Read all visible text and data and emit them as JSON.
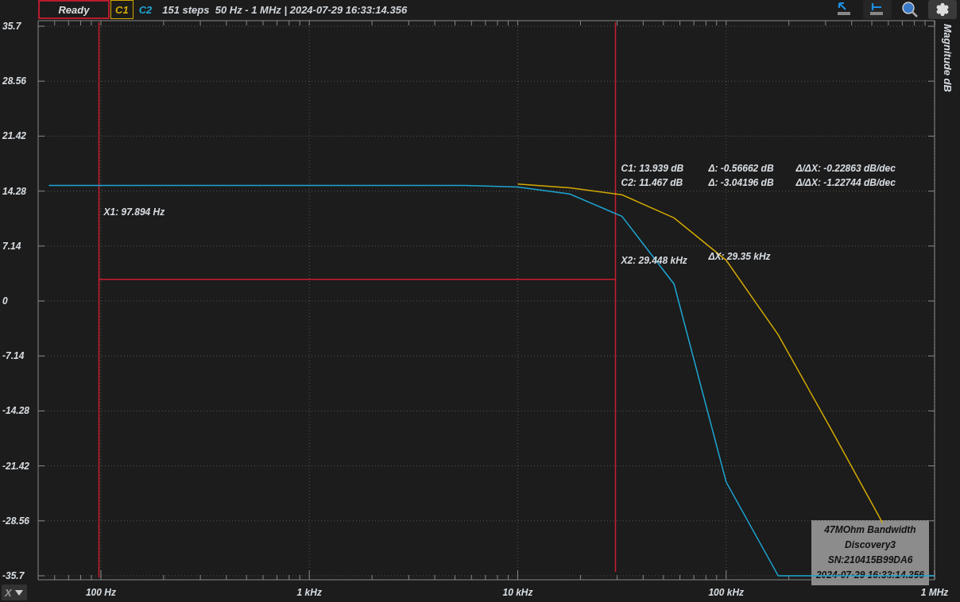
{
  "status": "Ready",
  "channels": [
    {
      "selected": true
    },
    {
      "selected": false
    }
  ],
  "sweep_info": "151 steps  50 Hz - 1 MHz | 2024-07-29 16:33:14.356",
  "cursor_labels": [
    "X1: 97.894 Hz",
    "X2: 29.448 kHz"
  ],
  "chart_data": {
    "type": "line",
    "ylabel": "Magnitude dB",
    "ylim": [
      -35.7,
      35.7
    ],
    "grid": true,
    "ref_lines": [
      {
        "axis": "y",
        "value": 2.8
      }
    ],
    "categories": [
      null,
      "100 Hz",
      null,
      null,
      null,
      "1 kHz",
      null,
      null,
      null,
      "10 kHz",
      null,
      null,
      null,
      "100 kHz",
      null,
      null,
      null,
      "1 MHz"
    ],
    "series": [
      {
        "name": "C1",
        "color": "#d4aa00",
        "values": [
          null,
          null,
          null,
          null,
          null,
          null,
          null,
          null,
          null,
          15.2,
          14.7,
          13.8,
          10.8,
          5.3,
          -4.4,
          -16.5,
          -28.8,
          null
        ]
      },
      {
        "name": "C2",
        "color": "#1ea5d2",
        "values": [
          15,
          15,
          15,
          15,
          15,
          15,
          15,
          15,
          15,
          14.8,
          13.9,
          11,
          2.2,
          -23.5,
          -35.7,
          -35.7,
          -35.7,
          -35.7
        ]
      }
    ],
    "yticks": [
      35.7,
      28.56,
      21.42,
      14.28,
      7.14,
      0,
      -7.14,
      -14.28,
      -21.42,
      -28.56,
      -35.7
    ]
  },
  "readouts": {
    "rows": [
      [
        "C1: 13.939 dB",
        "Δ: -0.56662 dB",
        "Δ/ΔX: -0.22863 dB/dec"
      ],
      [
        "C2: 11.467 dB",
        "Δ: -3.04196 dB",
        "Δ/ΔX: -1.22744 dB/dec"
      ]
    ],
    "delta_x": "ΔX: 29.35 kHz"
  },
  "info_box": [
    "47MOhm Bandwidth",
    "Discovery3",
    "SN:210415B99DA6",
    "2024-07-29 16:33:14.356"
  ],
  "axis_selector": "X"
}
